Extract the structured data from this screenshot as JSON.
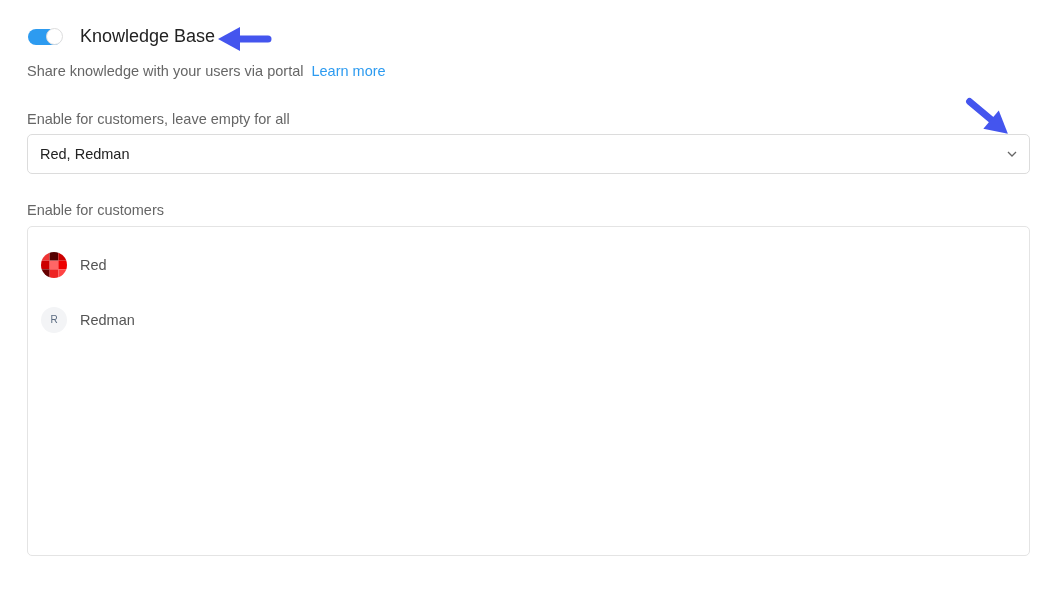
{
  "feature": {
    "title": "Knowledge Base",
    "on": true,
    "description": "Share knowledge with your users via portal",
    "link": "Learn more"
  },
  "select": {
    "label": "Enable for customers, leave empty for all",
    "value": "Red, Redman"
  },
  "customers": {
    "label": "Enable for customers",
    "items": [
      {
        "name": "Red",
        "avatar": {
          "kind": "pattern"
        }
      },
      {
        "name": "Redman",
        "avatar": {
          "kind": "initial",
          "text": "R"
        }
      }
    ]
  }
}
